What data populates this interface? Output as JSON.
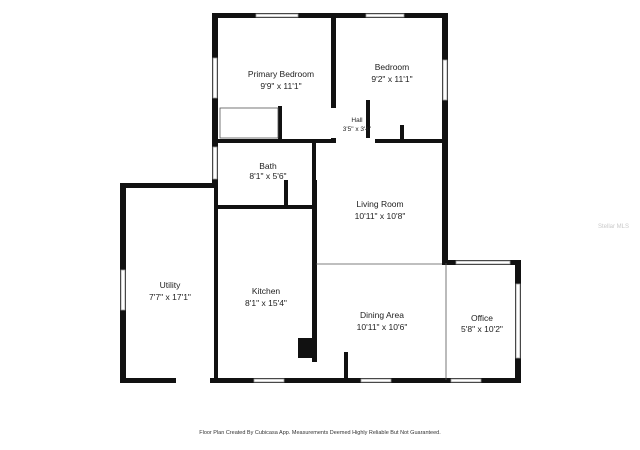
{
  "rooms": {
    "primary_bedroom": {
      "name": "Primary Bedroom",
      "dims": "9'9\" x 11'1\""
    },
    "bedroom": {
      "name": "Bedroom",
      "dims": "9'2\" x 11'1\""
    },
    "hall": {
      "name": "Hall",
      "dims": "3'5\" x 3'4\""
    },
    "bath": {
      "name": "Bath",
      "dims": "8'1\" x 5'6\""
    },
    "living_room": {
      "name": "Living Room",
      "dims": "10'11\" x 10'8\""
    },
    "utility": {
      "name": "Utility",
      "dims": "7'7\" x 17'1\""
    },
    "kitchen": {
      "name": "Kitchen",
      "dims": "8'1\" x 15'4\""
    },
    "dining_area": {
      "name": "Dining Area",
      "dims": "10'11\" x 10'6\""
    },
    "office": {
      "name": "Office",
      "dims": "5'8\" x 10'2\""
    }
  },
  "footer": "Floor Plan Created By Cubicasa App. Measurements Deemed Highly Reliable But Not Guaranteed.",
  "watermark": "Stellar MLS",
  "colors": {
    "wall": "#111111",
    "window": "#9a9a9a",
    "background": "#ffffff"
  }
}
